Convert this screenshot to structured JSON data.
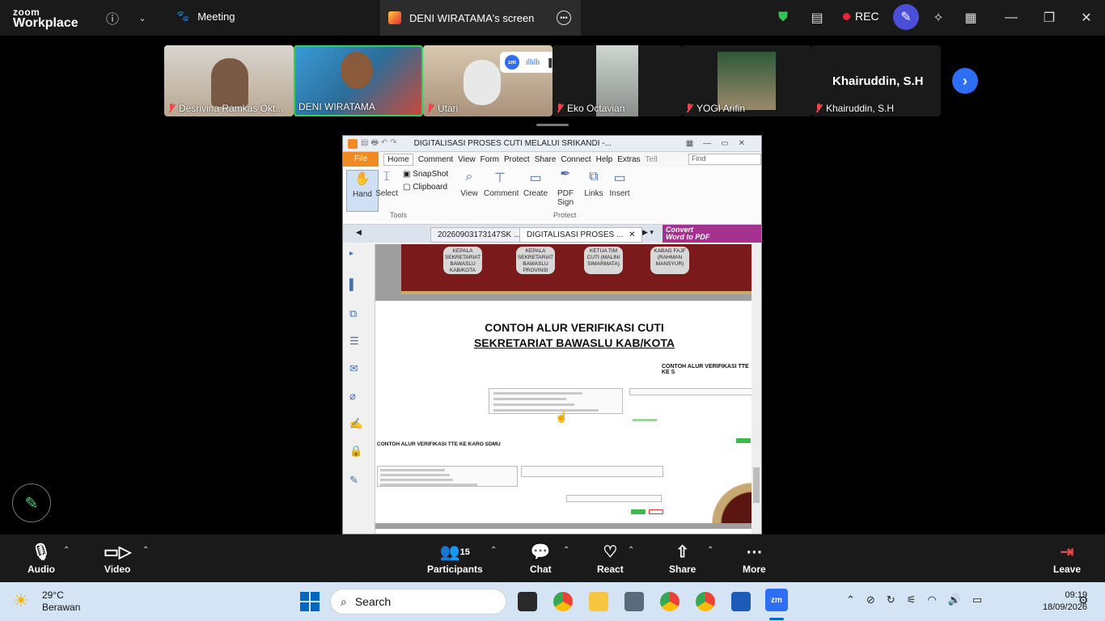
{
  "app": {
    "logo_top": "zoom",
    "logo_bottom": "Workplace"
  },
  "topbar": {
    "meeting_label": "Meeting",
    "screen_title": "DENI WIRATAMA's screen",
    "rec_label": "REC"
  },
  "participants": [
    {
      "name": "Desrivina Ramkas Okt..."
    },
    {
      "name": "DENI WIRATAMA"
    },
    {
      "name": "Utari"
    },
    {
      "name": "Eko Octavian"
    },
    {
      "name": "YOGI Arifin"
    },
    {
      "name": "Khairuddin, S.H",
      "title": "Khairuddin, S.H"
    }
  ],
  "pdf": {
    "title": "DIGITALISASI PROSES CUTI MELALUI SRIKANDI -...",
    "menu": [
      "File",
      "Home",
      "Comment",
      "View",
      "Form",
      "Protect",
      "Share",
      "Connect",
      "Help",
      "Extras"
    ],
    "tell": "Tell",
    "find_placeholder": "Find",
    "ribbon": {
      "hand": "Hand",
      "select": "Select",
      "snapshot": "SnapShot",
      "clipboard": "Clipboard",
      "tools_group": "Tools",
      "view": "View",
      "comment": "Comment",
      "create": "Create",
      "pdf_sign": "PDF Sign",
      "protect_group": "Protect",
      "links": "Links",
      "insert": "Insert"
    },
    "tabs": [
      {
        "label": "20260903173147SK ..."
      },
      {
        "label": "DIGITALISASI PROSES ..."
      }
    ],
    "convert": {
      "line1": "Convert",
      "line2": "Word to PDF"
    },
    "flow_boxes": [
      "KEPALA SEKRETARIAT BAWASLU KAB/KOTA",
      "KEPALA SEKRETARIAT BAWASLU PROVINSI",
      "KETUA TIM CUTI (MALINI SIMARMATA)",
      "KABAG FAJF (RAHMAN MANSYUR)"
    ],
    "page_title_line1": "CONTOH ALUR VERIFIKASI CUTI",
    "page_title_line2": "SEKRETARIAT BAWASLU KAB/KOTA",
    "sub_title_1": "CONTOH ALUR VERIFIKASI TTE KE S",
    "sub_title_2": "CONTOH ALUR VERIFIKASI TTE KE KARO SDMU"
  },
  "controls": {
    "audio": "Audio",
    "video": "Video",
    "participants": "Participants",
    "participants_count": "15",
    "chat": "Chat",
    "react": "React",
    "share": "Share",
    "more": "More",
    "leave": "Leave"
  },
  "taskbar": {
    "temp": "29°C",
    "weather": "Berawan",
    "search": "Search",
    "time": "09:19",
    "date": "18/09/2026"
  }
}
